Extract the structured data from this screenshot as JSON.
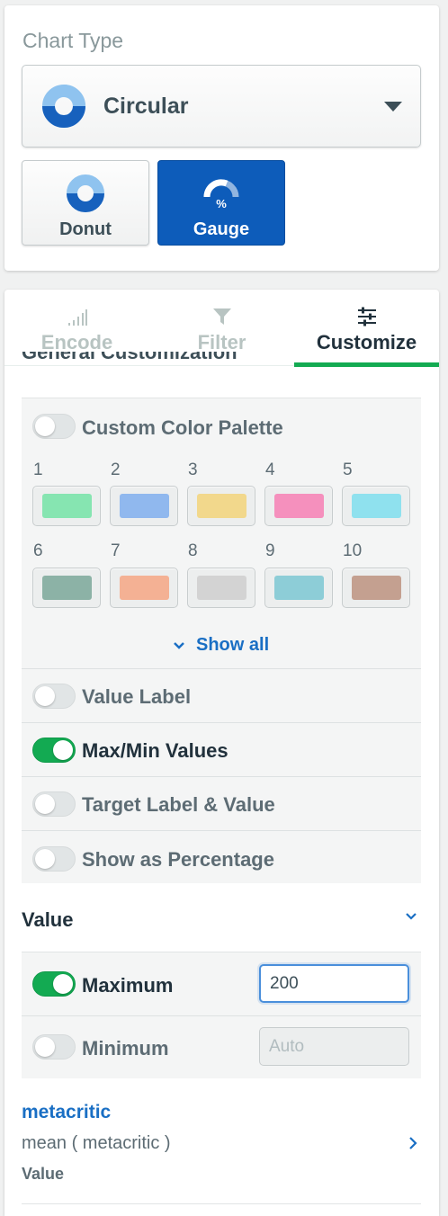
{
  "chart_type": {
    "title": "Chart Type",
    "selected": "Circular",
    "selected_icon": "circular-chart-icon",
    "subtypes": [
      {
        "label": "Donut",
        "icon": "donut-icon",
        "active": false
      },
      {
        "label": "Gauge",
        "icon": "gauge-icon",
        "active": true
      }
    ]
  },
  "tabs": [
    {
      "label": "Encode",
      "icon": "encode-icon",
      "active": false
    },
    {
      "label": "Filter",
      "icon": "filter-icon",
      "active": false
    },
    {
      "label": "Customize",
      "icon": "sliders-icon",
      "active": true
    }
  ],
  "general": {
    "heading": "General Customization",
    "custom_palette": {
      "label": "Custom Color Palette",
      "enabled": false
    },
    "swatches": [
      {
        "num": "1",
        "color": "#86e5b1"
      },
      {
        "num": "2",
        "color": "#90b8ee"
      },
      {
        "num": "3",
        "color": "#f2d88c"
      },
      {
        "num": "4",
        "color": "#f590bd"
      },
      {
        "num": "5",
        "color": "#8fe1ee"
      },
      {
        "num": "6",
        "color": "#8cb2a6"
      },
      {
        "num": "7",
        "color": "#f4b194"
      },
      {
        "num": "8",
        "color": "#d3d3d3"
      },
      {
        "num": "9",
        "color": "#8dcdd7"
      },
      {
        "num": "10",
        "color": "#c4a090"
      }
    ],
    "show_all": "Show all",
    "options": [
      {
        "label": "Value Label",
        "enabled": false
      },
      {
        "label": "Max/Min Values",
        "enabled": true
      },
      {
        "label": "Target Label & Value",
        "enabled": false
      },
      {
        "label": "Show as Percentage",
        "enabled": false
      }
    ]
  },
  "value_section": {
    "heading": "Value",
    "maximum": {
      "label": "Maximum",
      "enabled": true,
      "value": "200"
    },
    "minimum": {
      "label": "Minimum",
      "enabled": false,
      "placeholder": "Auto"
    }
  },
  "field": {
    "name": "metacritic",
    "aggregation": "mean ( metacritic )",
    "role": "Value"
  },
  "colors": {
    "accent_green": "#13aa52",
    "accent_blue": "#0d5cba",
    "link_blue": "#1a6fc4"
  }
}
